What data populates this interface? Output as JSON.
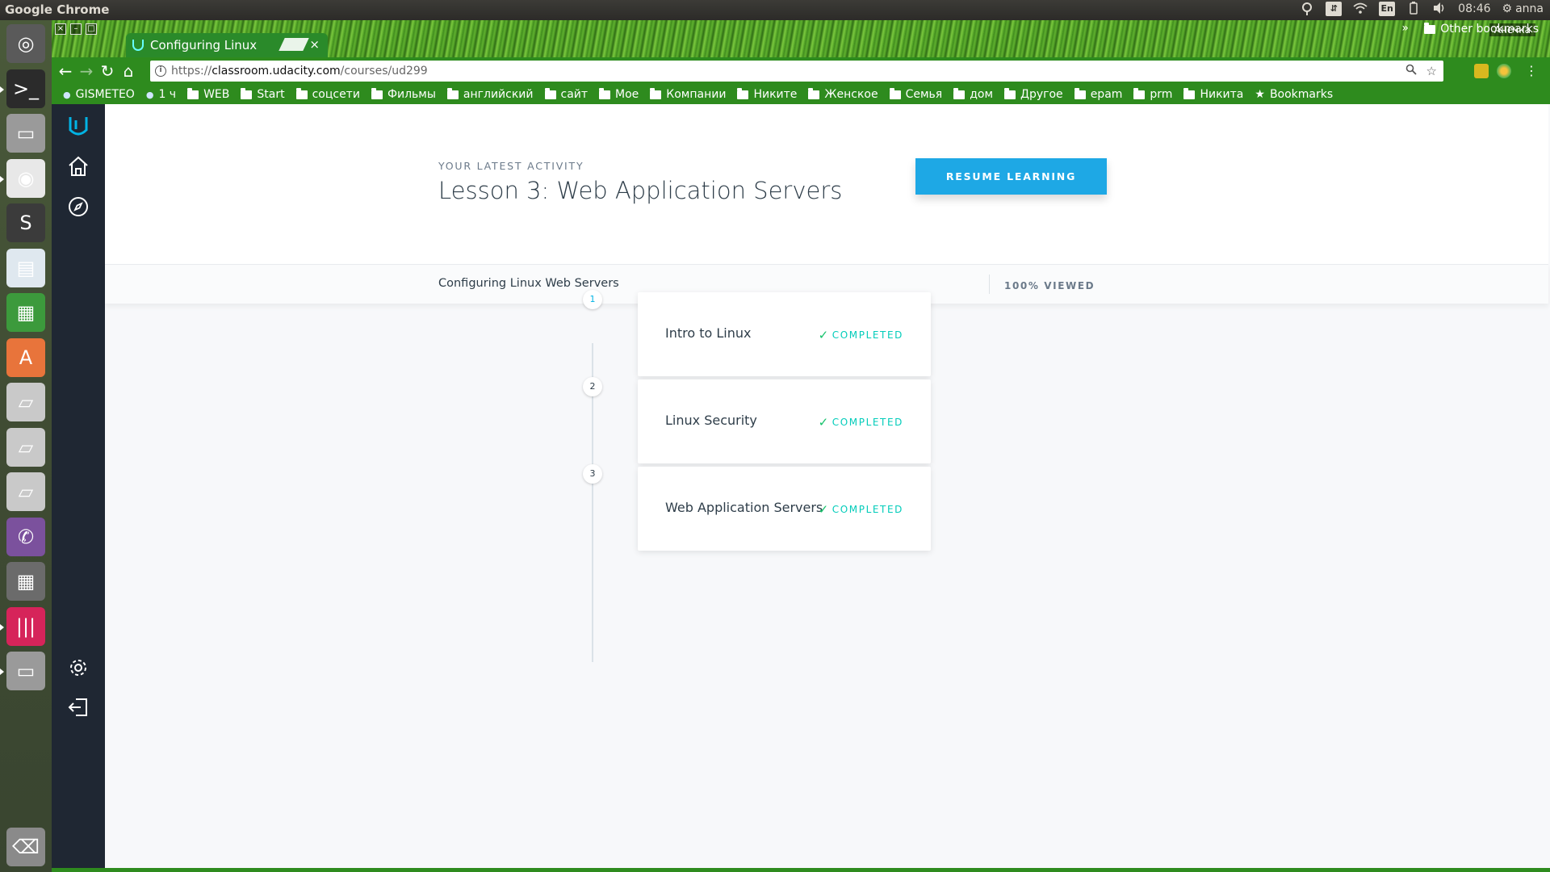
{
  "system_panel": {
    "app_title": "Google Chrome",
    "keyboard_layout": "En",
    "time": "08:46",
    "user": "anna"
  },
  "launcher": {
    "items": [
      {
        "name": "ubuntu-dash-icon",
        "bg": "#5a5a5a"
      },
      {
        "name": "terminal-icon",
        "bg": "#2b2b2b"
      },
      {
        "name": "files-icon",
        "bg": "#9a9a9a"
      },
      {
        "name": "chrome-icon",
        "bg": "#e8e8e8"
      },
      {
        "name": "sublime-text-icon",
        "bg": "#3b3b3b"
      },
      {
        "name": "writer-icon",
        "bg": "#dfe8ef"
      },
      {
        "name": "calc-icon",
        "bg": "#3c9a3c"
      },
      {
        "name": "software-center-icon",
        "bg": "#e8743b"
      },
      {
        "name": "drive-icon",
        "bg": "#c9c9c9"
      },
      {
        "name": "drive-icon",
        "bg": "#c9c9c9"
      },
      {
        "name": "drive-icon",
        "bg": "#c9c9c9"
      },
      {
        "name": "viber-icon",
        "bg": "#7b519d"
      },
      {
        "name": "calculator-icon",
        "bg": "#6b6b6b"
      },
      {
        "name": "app-icon",
        "bg": "#d6245a"
      },
      {
        "name": "files-icon",
        "bg": "#9a9a9a"
      },
      {
        "name": "trash-icon",
        "bg": "#8a8a8a"
      }
    ]
  },
  "browser": {
    "tab_title": "Configuring Linux",
    "profile_name": "Анечка",
    "url_scheme": "https://",
    "url_host": "classroom.udacity.com",
    "url_path": "/courses/ud299",
    "bookmarks": [
      {
        "label": "GISMETEO",
        "type": "site"
      },
      {
        "label": "1 ч",
        "type": "site"
      },
      {
        "label": "WEB",
        "type": "folder"
      },
      {
        "label": "Start",
        "type": "folder"
      },
      {
        "label": "соцсети",
        "type": "folder"
      },
      {
        "label": "Фильмы",
        "type": "folder"
      },
      {
        "label": "английский",
        "type": "folder"
      },
      {
        "label": "сайт",
        "type": "folder"
      },
      {
        "label": "Мое",
        "type": "folder"
      },
      {
        "label": "Компании",
        "type": "folder"
      },
      {
        "label": "Никите",
        "type": "folder"
      },
      {
        "label": "Женское",
        "type": "folder"
      },
      {
        "label": "Семья",
        "type": "folder"
      },
      {
        "label": "дом",
        "type": "folder"
      },
      {
        "label": "Другое",
        "type": "folder"
      },
      {
        "label": "epam",
        "type": "folder"
      },
      {
        "label": "prm",
        "type": "folder"
      },
      {
        "label": "Никита",
        "type": "folder"
      },
      {
        "label": "Bookmarks",
        "type": "star"
      }
    ],
    "bookmarks_more": "»",
    "other_bookmarks": "Other bookmarks"
  },
  "page": {
    "activity_label": "YOUR LATEST ACTIVITY",
    "lesson_title": "Lesson 3: Web Application Servers",
    "resume_button": "RESUME LEARNING",
    "course_name": "Configuring Linux Web Servers",
    "viewed": "100% VIEWED",
    "lessons": [
      {
        "number": "1",
        "title": "Intro to Linux",
        "status": "COMPLETED"
      },
      {
        "number": "2",
        "title": "Linux Security",
        "status": "COMPLETED"
      },
      {
        "number": "3",
        "title": "Web Application Servers",
        "status": "COMPLETED"
      }
    ]
  },
  "colors": {
    "accent": "#1ea8e5",
    "completed": "#02ccba",
    "nav_bg": "#1f2733"
  }
}
